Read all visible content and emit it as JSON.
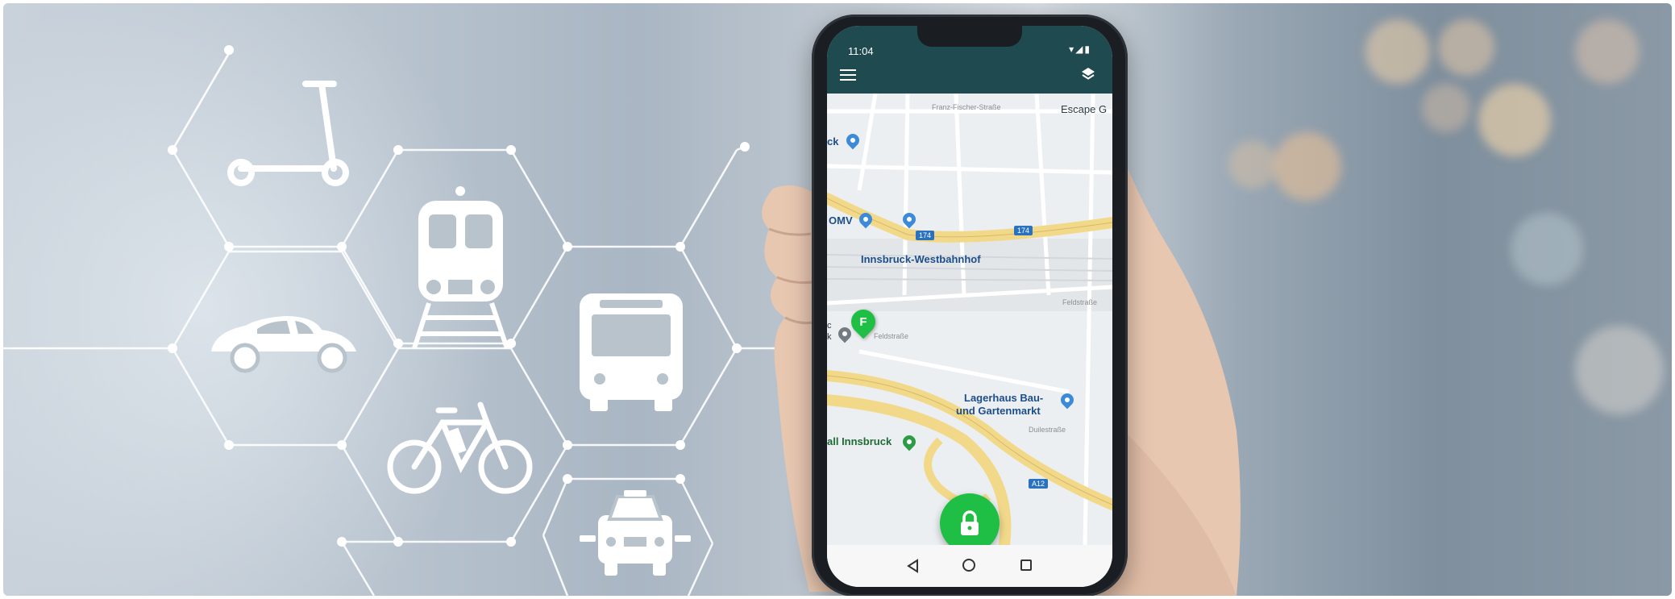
{
  "phone": {
    "status_time": "11:04",
    "status_icons": "▾◢▮"
  },
  "map": {
    "labels": {
      "franz_fischer_strasse": "Franz-Fischer-Straße",
      "escape": "Escape G",
      "ck": "ck",
      "omv": "OMV",
      "road_174_a": "174",
      "road_174_b": "174",
      "westbahnhof": "Innsbruck-Westbahnhof",
      "feldstrasse_a": "Feldstraße",
      "feldstrasse_b": "Feldstraße",
      "marker_f": "F",
      "lagerhaus_line1": "Lagerhaus Bau-",
      "lagerhaus_line2": "und Gartenmarkt",
      "duilestrasse": "Duilestraße",
      "innsbruck": "all Innsbruck",
      "road_a12": "A12",
      "ck_c": "c",
      "ck_k": "k"
    }
  },
  "colors": {
    "app_bar": "#1f4a4f",
    "accent_green": "#1fbf45",
    "map_road": "#f2d98a"
  },
  "icons": [
    "scooter-icon",
    "train-icon",
    "car-icon",
    "bus-icon",
    "bicycle-icon",
    "taxi-icon",
    "lock-icon",
    "menu-icon",
    "layers-icon"
  ]
}
